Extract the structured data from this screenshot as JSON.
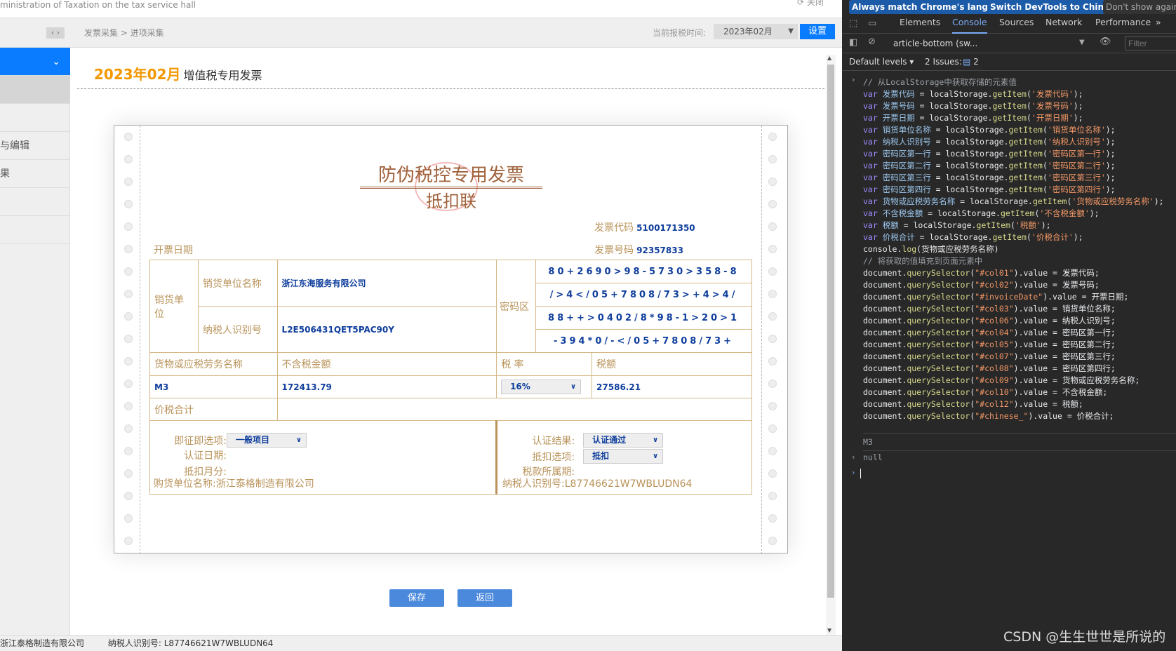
{
  "banner": {
    "text": "ministration of Taxation on the tax service hall",
    "close": "⟳ 关闭"
  },
  "header": {
    "breadcrumb": "发票采集 > 进项采集",
    "period_label": "当前报税时间:",
    "period_value": "2023年02月",
    "set_button": "设置",
    "nav_arrows": "‹ ›"
  },
  "sidebar": {
    "items": [
      {
        "label": ""
      },
      {
        "label": ""
      },
      {
        "label": ""
      },
      {
        "label": "与编辑"
      },
      {
        "label": "果"
      },
      {
        "label": ""
      },
      {
        "label": ""
      }
    ],
    "active_color": "#0a7cff",
    "chevron": "⌄"
  },
  "page": {
    "title_date": "2023年02月",
    "title_text": "增值税专用发票"
  },
  "invoice": {
    "title": "防伪税控专用发票",
    "subtitle": "抵扣联",
    "code_label": "发票代码",
    "code": "5100171350",
    "number_label": "发票号码",
    "number": "92357833",
    "date_label": "开票日期",
    "seller_label": "销货单位",
    "seller_name_label": "销货单位名称",
    "seller_name": "浙江东海服务有限公司",
    "taxid_label": "纳税人识别号",
    "seller_taxid": "L2E506431QET5PAC90Y",
    "cipher_label": "密码区",
    "cipher": [
      "80+2690>98-5730>358-8",
      "/>4</05+7808/73>+4>4/",
      "88++>0402/8*98-1>20>1",
      "-394*0/-</05+7808/73+"
    ],
    "goods_label": "货物或应税劳务名称",
    "amount_label": "不含税金额",
    "rate_label": "税 率",
    "tax_label": "税额",
    "goods": "M3",
    "amount": "172413.79",
    "rate": "16%",
    "tax": "27586.21",
    "total_label": "价税合计",
    "jzjt_label": "即征即选项:",
    "jzjt_value": "一般项目",
    "auth_date_label": "认证日期:",
    "deduct_month_label": "抵扣月分:",
    "auth_result_label": "认证结果:",
    "auth_result_value": "认证通过",
    "deduct_opt_label": "抵扣选项:",
    "deduct_opt_value": "抵扣",
    "tax_period_label": "税款所属期:",
    "buyer_label": "购货单位名称:",
    "buyer_name": "浙江泰格制造有限公司",
    "buyer_taxid_label": "纳税人识别号:",
    "buyer_taxid": "L87746621W7WBLUDN64"
  },
  "actions": {
    "save": "保存",
    "back": "返回"
  },
  "footer": {
    "company": "浙江泰格制造有限公司",
    "taxid_label": "纳税人识别号:",
    "taxid": "L87746621W7WBLUDN64"
  },
  "devtools": {
    "infobar": [
      "Always match Chrome's language",
      "Switch DevTools to Chinese",
      "Don't show again"
    ],
    "tabs": [
      "Elements",
      "Console",
      "Sources",
      "Network",
      "Performance",
      "»"
    ],
    "active_tab": "Console",
    "context": "article-bottom (sw...",
    "filter_placeholder": "Filter",
    "levels": "Default levels ▾",
    "issues": "2 Issues:",
    "issues_count": "2",
    "code": [
      [
        [
          "cm",
          "// 从LocalStorage中获取存储的元素值"
        ]
      ],
      [
        [
          "kw",
          "var "
        ],
        [
          "id",
          "发票代码"
        ],
        [
          "tx",
          " = localStorage."
        ],
        [
          "fn",
          "getItem"
        ],
        [
          "tx",
          "("
        ],
        [
          "st",
          "'发票代码'"
        ],
        [
          "tx",
          ");"
        ]
      ],
      [
        [
          "kw",
          "var "
        ],
        [
          "id",
          "发票号码"
        ],
        [
          "tx",
          " = localStorage."
        ],
        [
          "fn",
          "getItem"
        ],
        [
          "tx",
          "("
        ],
        [
          "st",
          "'发票号码'"
        ],
        [
          "tx",
          ");"
        ]
      ],
      [
        [
          "kw",
          "var "
        ],
        [
          "id",
          "开票日期"
        ],
        [
          "tx",
          " = localStorage."
        ],
        [
          "fn",
          "getItem"
        ],
        [
          "tx",
          "("
        ],
        [
          "st",
          "'开票日期'"
        ],
        [
          "tx",
          ");"
        ]
      ],
      [
        [
          "kw",
          "var "
        ],
        [
          "id",
          "销货单位名称"
        ],
        [
          "tx",
          " = localStorage."
        ],
        [
          "fn",
          "getItem"
        ],
        [
          "tx",
          "("
        ],
        [
          "st",
          "'销货单位名称'"
        ],
        [
          "tx",
          ");"
        ]
      ],
      [
        [
          "kw",
          "var "
        ],
        [
          "id",
          "纳税人识别号"
        ],
        [
          "tx",
          " = localStorage."
        ],
        [
          "fn",
          "getItem"
        ],
        [
          "tx",
          "("
        ],
        [
          "st",
          "'纳税人识别号'"
        ],
        [
          "tx",
          ");"
        ]
      ],
      [
        [
          "kw",
          "var "
        ],
        [
          "id",
          "密码区第一行"
        ],
        [
          "tx",
          " = localStorage."
        ],
        [
          "fn",
          "getItem"
        ],
        [
          "tx",
          "("
        ],
        [
          "st",
          "'密码区第一行'"
        ],
        [
          "tx",
          ");"
        ]
      ],
      [
        [
          "kw",
          "var "
        ],
        [
          "id",
          "密码区第二行"
        ],
        [
          "tx",
          " = localStorage."
        ],
        [
          "fn",
          "getItem"
        ],
        [
          "tx",
          "("
        ],
        [
          "st",
          "'密码区第二行'"
        ],
        [
          "tx",
          ");"
        ]
      ],
      [
        [
          "kw",
          "var "
        ],
        [
          "id",
          "密码区第三行"
        ],
        [
          "tx",
          " = localStorage."
        ],
        [
          "fn",
          "getItem"
        ],
        [
          "tx",
          "("
        ],
        [
          "st",
          "'密码区第三行'"
        ],
        [
          "tx",
          ");"
        ]
      ],
      [
        [
          "kw",
          "var "
        ],
        [
          "id",
          "密码区第四行"
        ],
        [
          "tx",
          " = localStorage."
        ],
        [
          "fn",
          "getItem"
        ],
        [
          "tx",
          "("
        ],
        [
          "st",
          "'密码区第四行'"
        ],
        [
          "tx",
          ");"
        ]
      ],
      [
        [
          "kw",
          "var "
        ],
        [
          "id",
          "货物或应税劳务名称"
        ],
        [
          "tx",
          " = localStorage."
        ],
        [
          "fn",
          "getItem"
        ],
        [
          "tx",
          "("
        ],
        [
          "st",
          "'货物或应税劳务名称'"
        ],
        [
          "tx",
          ");"
        ]
      ],
      [
        [
          "kw",
          "var "
        ],
        [
          "id",
          "不含税金额"
        ],
        [
          "tx",
          " = localStorage."
        ],
        [
          "fn",
          "getItem"
        ],
        [
          "tx",
          "("
        ],
        [
          "st",
          "'不含税金额'"
        ],
        [
          "tx",
          ");"
        ]
      ],
      [
        [
          "kw",
          "var "
        ],
        [
          "id",
          "税额"
        ],
        [
          "tx",
          " = localStorage."
        ],
        [
          "fn",
          "getItem"
        ],
        [
          "tx",
          "("
        ],
        [
          "st",
          "'税额'"
        ],
        [
          "tx",
          ");"
        ]
      ],
      [
        [
          "kw",
          "var "
        ],
        [
          "id",
          "价税合计"
        ],
        [
          "tx",
          " = localStorage."
        ],
        [
          "fn",
          "getItem"
        ],
        [
          "tx",
          "("
        ],
        [
          "st",
          "'价税合计'"
        ],
        [
          "tx",
          ");"
        ]
      ],
      [
        [
          "tx",
          "console."
        ],
        [
          "fn",
          "log"
        ],
        [
          "tx",
          "(货物或应税劳务名称)"
        ]
      ],
      [
        [
          "cm",
          "// 将获取的值填充到页面元素中"
        ]
      ],
      [
        [
          "tx",
          "document."
        ],
        [
          "fn",
          "querySelector"
        ],
        [
          "tx",
          "("
        ],
        [
          "st",
          "\"#col01\""
        ],
        [
          "tx",
          ").value = 发票代码;"
        ]
      ],
      [
        [
          "tx",
          "document."
        ],
        [
          "fn",
          "querySelector"
        ],
        [
          "tx",
          "("
        ],
        [
          "st",
          "\"#col02\""
        ],
        [
          "tx",
          ").value = 发票号码;"
        ]
      ],
      [
        [
          "tx",
          "document."
        ],
        [
          "fn",
          "querySelector"
        ],
        [
          "tx",
          "("
        ],
        [
          "st",
          "\"#invoiceDate\""
        ],
        [
          "tx",
          ").value = 开票日期;"
        ]
      ],
      [
        [
          "tx",
          "document."
        ],
        [
          "fn",
          "querySelector"
        ],
        [
          "tx",
          "("
        ],
        [
          "st",
          "\"#col03\""
        ],
        [
          "tx",
          ").value = 销货单位名称;"
        ]
      ],
      [
        [
          "tx",
          "document."
        ],
        [
          "fn",
          "querySelector"
        ],
        [
          "tx",
          "("
        ],
        [
          "st",
          "\"#col06\""
        ],
        [
          "tx",
          ").value = 纳税人识别号;"
        ]
      ],
      [
        [
          "tx",
          "document."
        ],
        [
          "fn",
          "querySelector"
        ],
        [
          "tx",
          "("
        ],
        [
          "st",
          "\"#col04\""
        ],
        [
          "tx",
          ").value = 密码区第一行;"
        ]
      ],
      [
        [
          "tx",
          "document."
        ],
        [
          "fn",
          "querySelector"
        ],
        [
          "tx",
          "("
        ],
        [
          "st",
          "\"#col05\""
        ],
        [
          "tx",
          ").value = 密码区第二行;"
        ]
      ],
      [
        [
          "tx",
          "document."
        ],
        [
          "fn",
          "querySelector"
        ],
        [
          "tx",
          "("
        ],
        [
          "st",
          "\"#col07\""
        ],
        [
          "tx",
          ").value = 密码区第三行;"
        ]
      ],
      [
        [
          "tx",
          "document."
        ],
        [
          "fn",
          "querySelector"
        ],
        [
          "tx",
          "("
        ],
        [
          "st",
          "\"#col08\""
        ],
        [
          "tx",
          ").value = 密码区第四行;"
        ]
      ],
      [
        [
          "tx",
          "document."
        ],
        [
          "fn",
          "querySelector"
        ],
        [
          "tx",
          "("
        ],
        [
          "st",
          "\"#col09\""
        ],
        [
          "tx",
          ").value = 货物或应税劳务名称;"
        ]
      ],
      [
        [
          "tx",
          "document."
        ],
        [
          "fn",
          "querySelector"
        ],
        [
          "tx",
          "("
        ],
        [
          "st",
          "\"#col10\""
        ],
        [
          "tx",
          ").value = 不含税金额;"
        ]
      ],
      [
        [
          "tx",
          "document."
        ],
        [
          "fn",
          "querySelector"
        ],
        [
          "tx",
          "("
        ],
        [
          "st",
          "\"#col12\""
        ],
        [
          "tx",
          ").value = 税额;"
        ]
      ],
      [
        [
          "tx",
          "document."
        ],
        [
          "fn",
          "querySelector"
        ],
        [
          "tx",
          "("
        ],
        [
          "st",
          "\"#chinese_\""
        ],
        [
          "tx",
          ").value = 价税合计;"
        ]
      ]
    ],
    "log_output": "M3",
    "return_value": "null"
  },
  "watermark": "CSDN @生生世世是所说的"
}
